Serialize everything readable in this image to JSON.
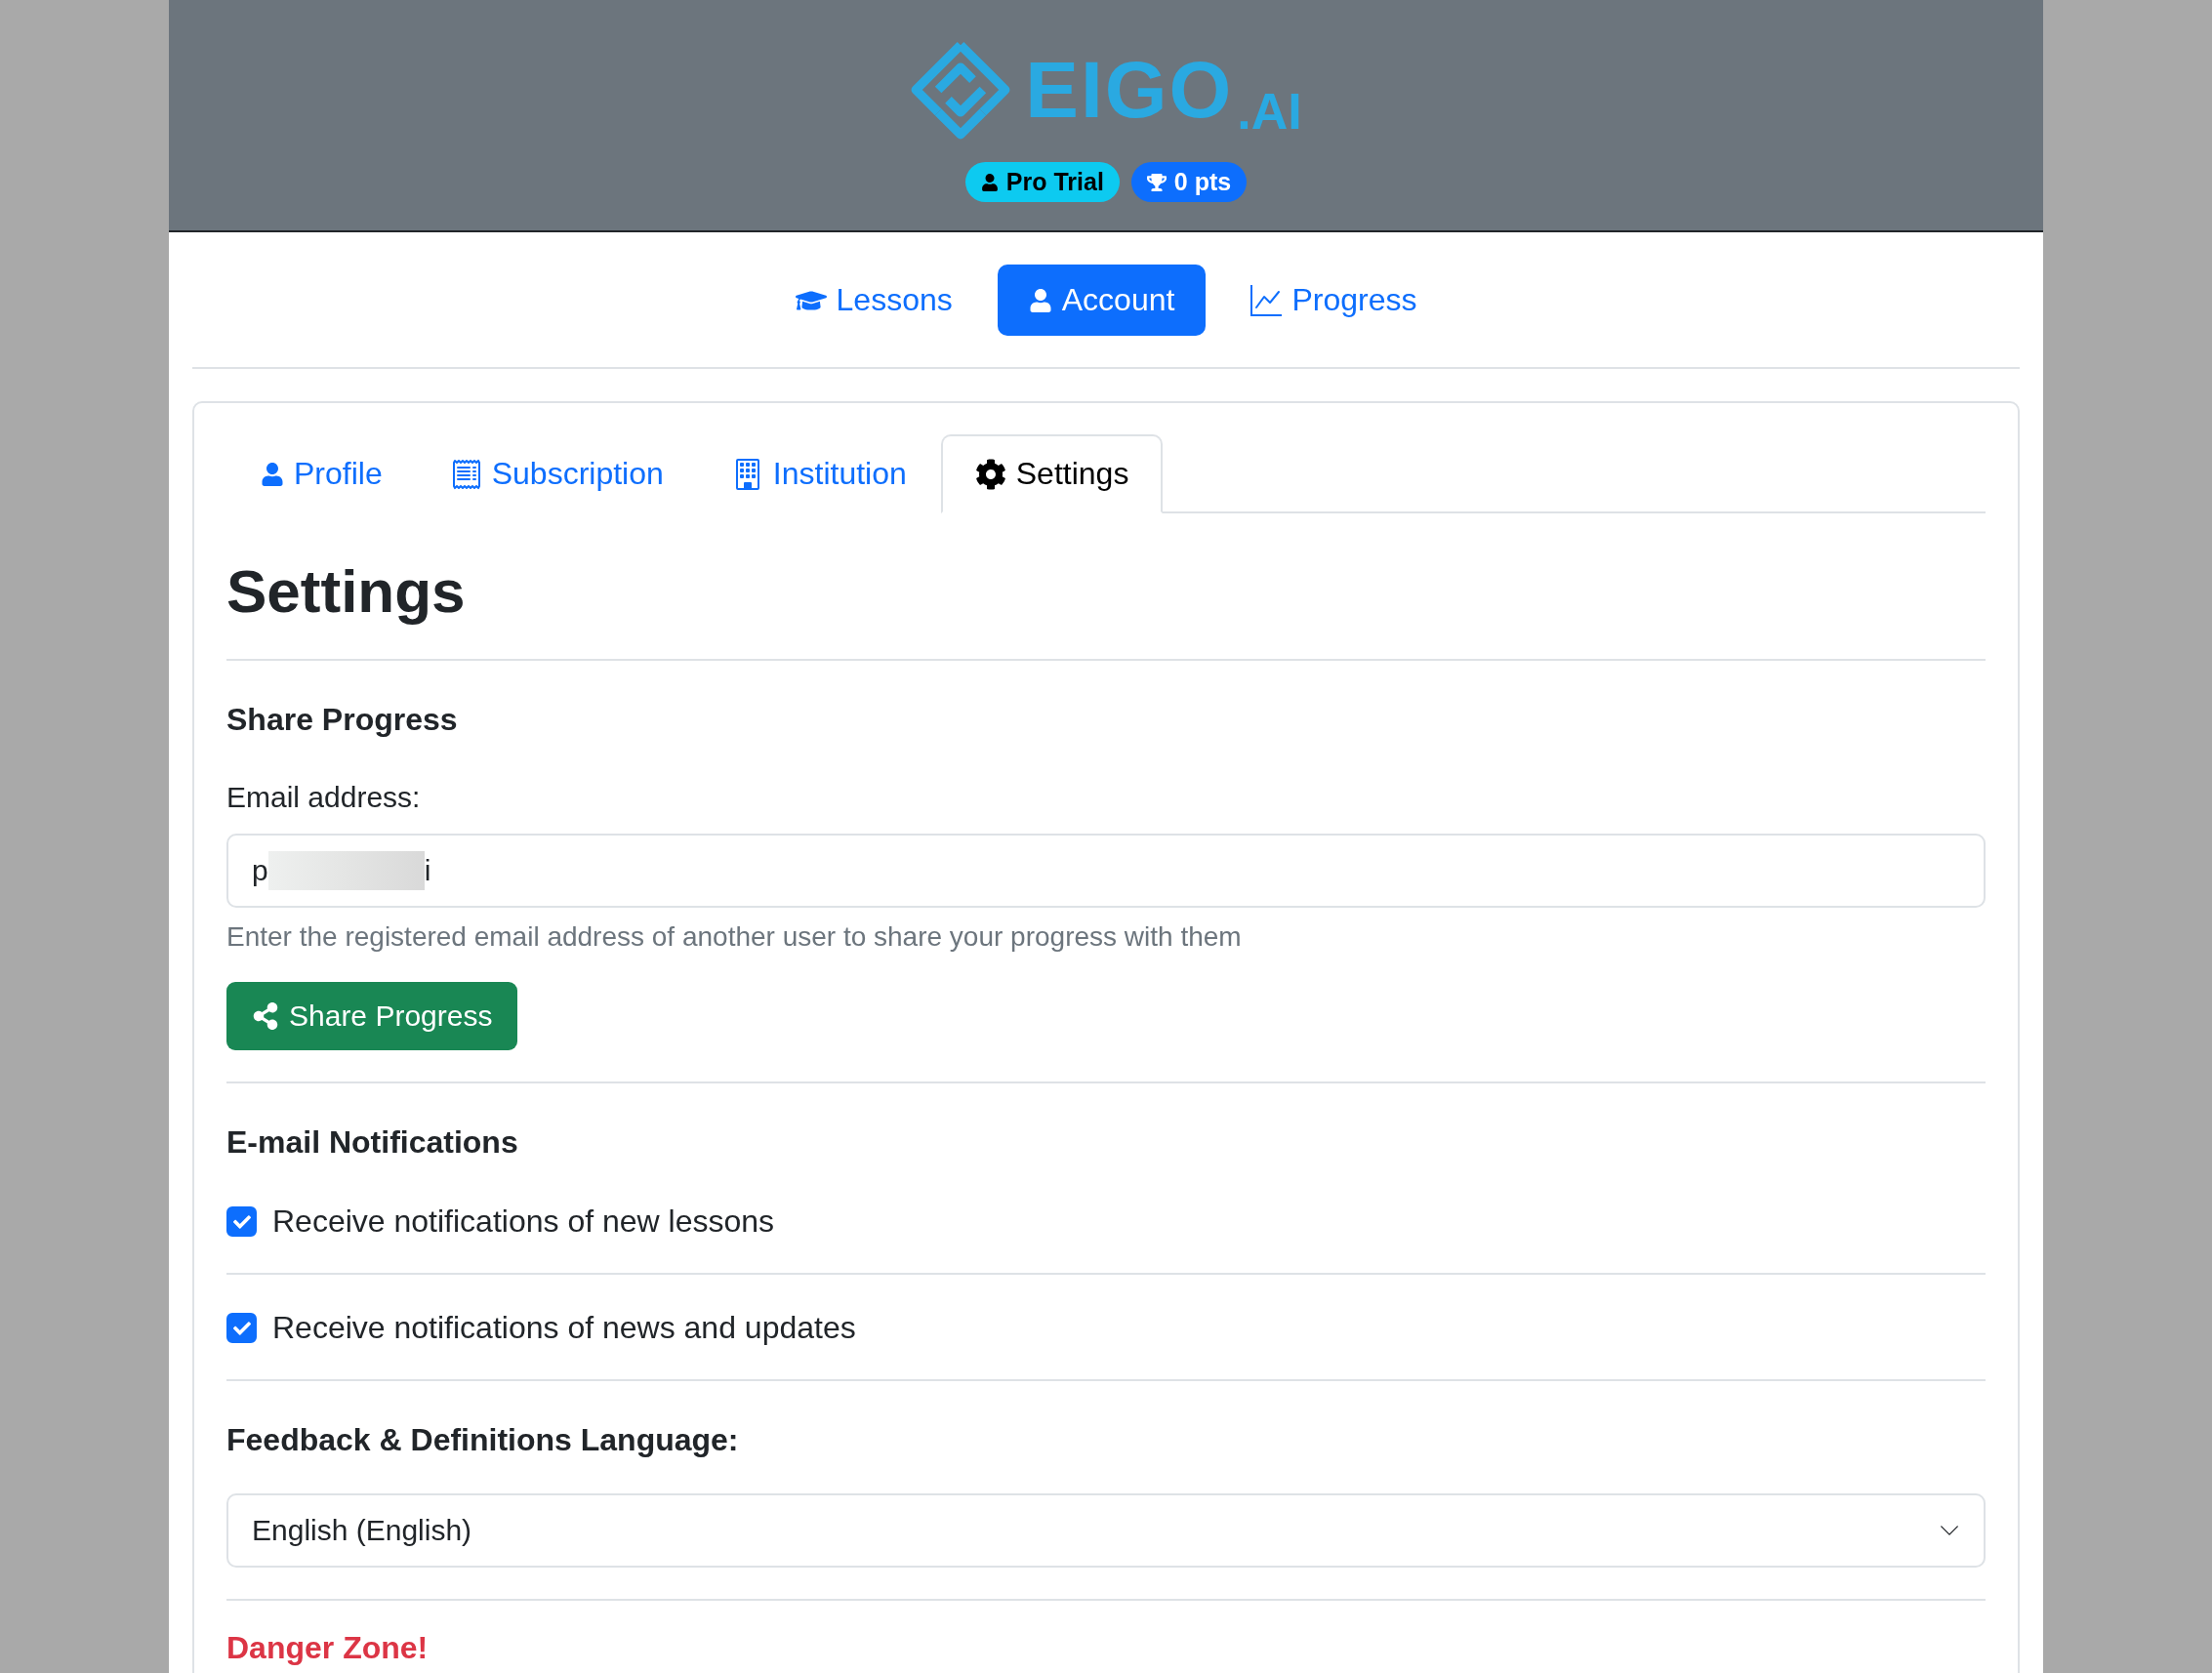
{
  "header": {
    "logo": {
      "word": "EIGO",
      "suffix": ".AI"
    },
    "badges": [
      {
        "kind": "plan",
        "label": "Pro Trial"
      },
      {
        "kind": "points",
        "label": "0 pts"
      }
    ]
  },
  "nav": [
    {
      "kind": "lessons",
      "label": "Lessons",
      "selected": false
    },
    {
      "kind": "account",
      "label": "Account",
      "selected": true
    },
    {
      "kind": "progress",
      "label": "Progress",
      "selected": false
    }
  ],
  "tabs": [
    {
      "kind": "profile",
      "label": "Profile",
      "selected": false
    },
    {
      "kind": "subscription",
      "label": "Subscription",
      "selected": false
    },
    {
      "kind": "institution",
      "label": "Institution",
      "selected": false
    },
    {
      "kind": "settings",
      "label": "Settings",
      "selected": true
    }
  ],
  "title": "Settings",
  "share": {
    "heading": "Share Progress",
    "label": "Email address:",
    "value_start": "p",
    "value_end": "i",
    "help": "Enter the registered email address of another user to share your progress with them",
    "button": "Share Progress"
  },
  "notifications": {
    "heading": "E-mail Notifications",
    "options": [
      {
        "label": "Receive notifications of new lessons",
        "checked": true
      },
      {
        "label": "Receive notifications of news and updates",
        "checked": true
      }
    ]
  },
  "language": {
    "heading": "Feedback & Definitions Language:",
    "value": "English (English)"
  },
  "danger": {
    "heading": "Danger Zone!"
  }
}
